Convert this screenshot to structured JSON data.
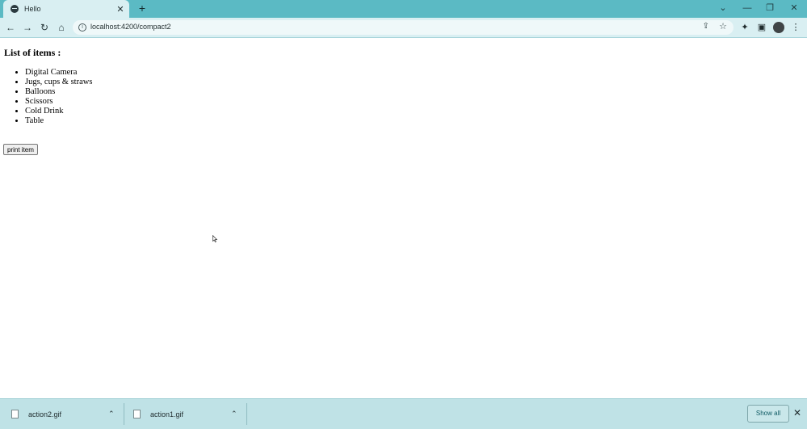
{
  "browser": {
    "tab": {
      "title": "Hello",
      "favicon": "globe-icon"
    },
    "new_tab": "+",
    "window_controls": {
      "dropdown": "⌄",
      "minimize": "—",
      "restore": "❐",
      "close": "✕"
    },
    "nav": {
      "back": "←",
      "forward": "→",
      "reload": "↻",
      "home": "⌂"
    },
    "url": "localhost:4200/compact2",
    "accent": "#5bbac4"
  },
  "page": {
    "heading": "List of items :",
    "items": [
      "Digital Camera",
      "Jugs, cups & straws",
      "Balloons",
      "Scissors",
      "Cold Drink",
      "Table"
    ],
    "button_label": "print item"
  },
  "downloads": {
    "files": [
      {
        "name": "action2.gif"
      },
      {
        "name": "action1.gif"
      }
    ],
    "show_all_label": "Show all"
  }
}
